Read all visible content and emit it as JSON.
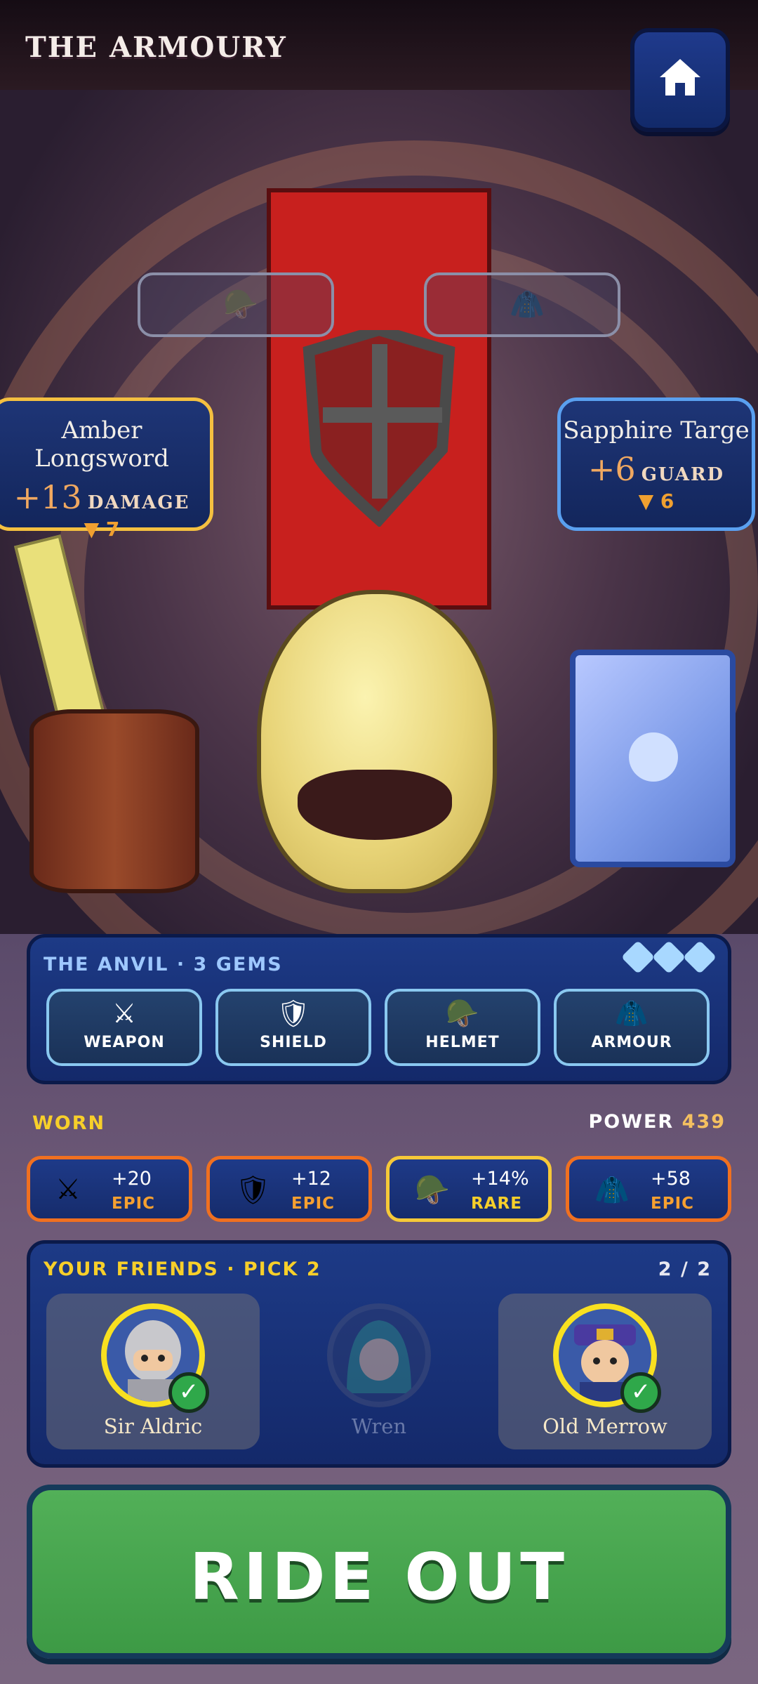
{
  "header": {
    "title": "THE ARMOURY",
    "home_icon": "home-icon"
  },
  "scene": {
    "empty_slots": [
      {
        "icon": "helmet-icon",
        "glyph": "🪖"
      },
      {
        "icon": "armour-icon",
        "glyph": "🧥"
      }
    ],
    "weapon_card": {
      "name": "Amber Longsword",
      "value": "+13",
      "unit": "DAMAGE",
      "delta": "▼ 7",
      "border": "#f4c040"
    },
    "shield_card": {
      "name": "Sapphire Targe",
      "value": "+6",
      "unit": "GUARD",
      "delta": "▼ 6",
      "border": "#5aa0f0"
    }
  },
  "anvil": {
    "title": "THE ANVIL · 3 GEMS",
    "gems": 3,
    "tabs": [
      {
        "label": "WEAPON",
        "glyph": "⚔",
        "icon": "swords-icon"
      },
      {
        "label": "SHIELD",
        "glyph": "🛡",
        "icon": "shield-icon"
      },
      {
        "label": "HELMET",
        "glyph": "🪖",
        "icon": "helmet-icon"
      },
      {
        "label": "ARMOUR",
        "glyph": "🧥",
        "icon": "armour-icon"
      }
    ]
  },
  "worn": {
    "label": "WORN",
    "power_label": "POWER",
    "power_value": "439",
    "items": [
      {
        "bonus": "+20",
        "rarity": "EPIC",
        "glyph": "⚔",
        "icon": "swords-icon"
      },
      {
        "bonus": "+12",
        "rarity": "EPIC",
        "glyph": "🛡",
        "icon": "shield-icon"
      },
      {
        "bonus": "+14%",
        "rarity": "RARE",
        "glyph": "🪖",
        "icon": "helmet-icon"
      },
      {
        "bonus": "+58",
        "rarity": "EPIC",
        "glyph": "🧥",
        "icon": "armour-icon"
      }
    ]
  },
  "friends": {
    "title": "YOUR FRIENDS · PICK 2",
    "count": "2 / 2",
    "list": [
      {
        "name": "Sir Aldric",
        "selected": true,
        "check": "✓"
      },
      {
        "name": "Wren",
        "selected": false
      },
      {
        "name": "Old Merrow",
        "selected": true,
        "check": "✓"
      }
    ]
  },
  "cta": {
    "label": "RIDE OUT"
  },
  "colors": {
    "accent_gold": "#f7cf2a",
    "epic_orange": "#f07020",
    "cta_green": "#4caa52",
    "panel_blue": "#1d3a86"
  }
}
